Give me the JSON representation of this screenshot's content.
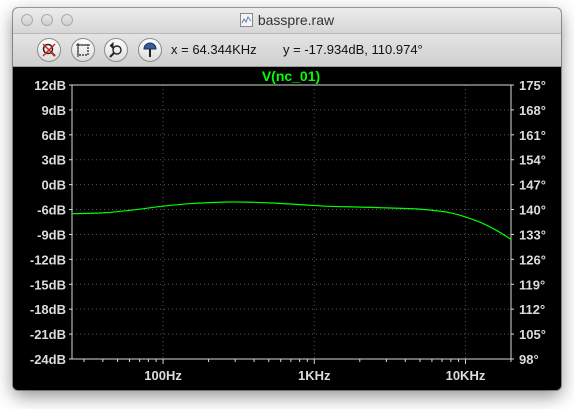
{
  "window": {
    "title": "basspre.raw"
  },
  "toolbar": {
    "buttons": [
      {
        "name": "autorange-button",
        "icon": "magnify-cross-icon"
      },
      {
        "name": "zoom-box-button",
        "icon": "zoom-box-icon"
      },
      {
        "name": "zoom-back-button",
        "icon": "zoom-back-icon"
      },
      {
        "name": "pick-trace-button",
        "icon": "probe-icon"
      }
    ],
    "cursor_x": "x = 64.344KHz",
    "cursor_y": "y = -17.934dB, 110.974°"
  },
  "colors": {
    "background": "#000000",
    "trace": "#00ff00",
    "grid": "#444444",
    "tick_text": "#dcdcdc"
  },
  "chart_data": {
    "type": "line",
    "title": "V(nc_01)",
    "x_scale": "log",
    "xlim": [
      25,
      20000
    ],
    "x_ticks": [
      {
        "value": 100,
        "label": "100Hz"
      },
      {
        "value": 1000,
        "label": "1KHz"
      },
      {
        "value": 10000,
        "label": "10KHz"
      }
    ],
    "y_left": {
      "unit": "dB",
      "ylim": [
        -24,
        12
      ],
      "tick_labels": [
        "12dB",
        "9dB",
        "6dB",
        "3dB",
        "0dB",
        "-6dB",
        "-9dB",
        "-12dB",
        "-15dB",
        "-18dB",
        "-21dB",
        "-24dB"
      ],
      "tick_values": [
        12,
        9,
        6,
        3,
        0,
        -6,
        -9,
        -12,
        -15,
        -18,
        -21,
        -24
      ]
    },
    "y_right": {
      "unit": "°",
      "ylim": [
        98,
        175
      ],
      "tick_labels": [
        "175°",
        "168°",
        "161°",
        "154°",
        "147°",
        "140°",
        "133°",
        "126°",
        "119°",
        "112°",
        "105°",
        "98°"
      ]
    },
    "series": [
      {
        "name": "V(nc_01)",
        "axis": "left",
        "x": [
          25,
          40,
          60,
          100,
          150,
          250,
          350,
          500,
          800,
          1200,
          2000,
          3000,
          5000,
          8000,
          12000,
          16000,
          20000
        ],
        "y": [
          -6.5,
          -6.4,
          -6.1,
          -5.2,
          -4.6,
          -4.2,
          -4.2,
          -4.4,
          -4.8,
          -5.2,
          -5.4,
          -5.6,
          -5.9,
          -6.4,
          -7.4,
          -8.5,
          -9.6
        ]
      }
    ]
  }
}
